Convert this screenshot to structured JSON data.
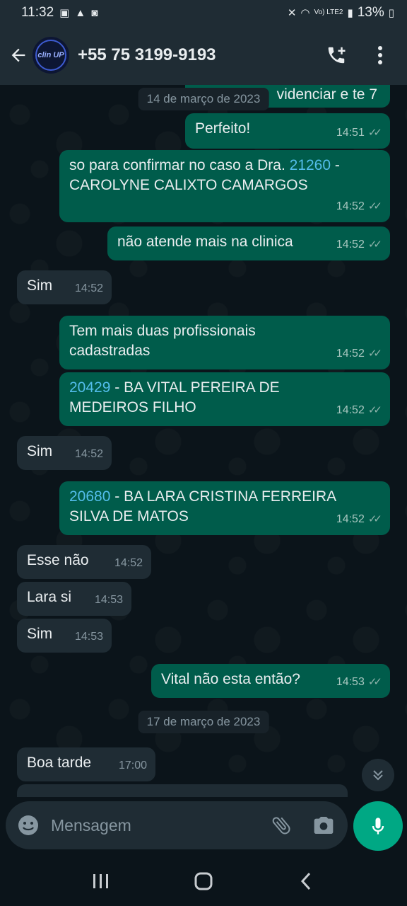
{
  "status_bar": {
    "time": "11:32",
    "battery": "13%",
    "network_label": "Vo) LTE2"
  },
  "header": {
    "contact": "+55 75 3199-9193",
    "avatar_text": "clin UP"
  },
  "chat": {
    "partial_top": "videnciar e te 7",
    "date1": "14 de março de 2023",
    "messages": [
      {
        "text": "Perfeito!",
        "time": "14:51"
      },
      {
        "text_a": "so para confirmar no caso a Dra. ",
        "num": "21260",
        "text_b": " -",
        "text_c": "CAROLYNE CALIXTO CAMARGOS",
        "time": "14:52"
      },
      {
        "text": "não atende mais na clinica",
        "time": "14:52"
      },
      {
        "text": "Sim",
        "time": "14:52"
      },
      {
        "text_a": "Tem mais duas profissionais",
        "text_b": "cadastradas",
        "time": "14:52"
      },
      {
        "num": "20429",
        "text_a": " - BA  VITAL PEREIRA DE",
        "text_b": "MEDEIROS FILHO",
        "time": "14:52"
      },
      {
        "text": "Sim",
        "time": "14:52"
      },
      {
        "num": "20680",
        "text_a": " - BA  LARA CRISTINA FERREIRA",
        "text_b": "SILVA DE MATOS",
        "time": "14:52"
      },
      {
        "text": "Esse não",
        "time": "14:52"
      },
      {
        "text": "Lara si",
        "time": "14:53"
      },
      {
        "text": "Sim",
        "time": "14:53"
      },
      {
        "text": "Vital não esta então?",
        "time": "14:53"
      },
      {
        "text": "Boa tarde",
        "time": "17:00"
      }
    ],
    "date2": "17 de março de 2023"
  },
  "input": {
    "placeholder": "Mensagem"
  },
  "colors": {
    "outgoing": "#005c4b",
    "incoming": "#1f2c34",
    "accent": "#00a884",
    "link_number": "#53bdeb"
  }
}
